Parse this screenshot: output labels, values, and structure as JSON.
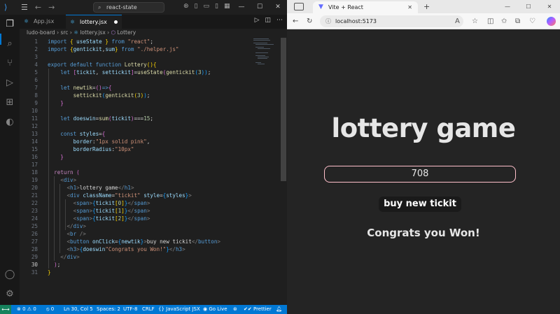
{
  "vscode": {
    "command_center": "react-state",
    "tabs": [
      {
        "label": "App.jsx",
        "active": false,
        "modified": false
      },
      {
        "label": "lottery.jsx",
        "active": true,
        "modified": true
      }
    ],
    "breadcrumb": [
      "ludo-board",
      "src",
      "lottery.jsx",
      "Lottery"
    ],
    "line_numbers": [
      "1",
      "2",
      "3",
      "4",
      "5",
      "6",
      "7",
      "8",
      "9",
      "10",
      "11",
      "12",
      "13",
      "14",
      "15",
      "16",
      "17",
      "18",
      "19",
      "20",
      "21",
      "22",
      "23",
      "24",
      "25",
      "26",
      "27",
      "28",
      "29",
      "30",
      "31"
    ],
    "status": {
      "errors": "0",
      "warnings": "0",
      "ports": "0",
      "position": "Ln 30, Col 5",
      "spaces": "Spaces: 2",
      "encoding": "UTF-8",
      "eol": "CRLF",
      "language": "JavaScript JSX",
      "golive": "Go Live",
      "prettier": "Prettier"
    },
    "icons": [
      "vscode-logo-icon",
      "menu-icon",
      "back-icon",
      "forward-icon",
      "search-icon",
      "layout-icon",
      "run-icon",
      "split-icon",
      "more-icon",
      "files-icon",
      "search-icon",
      "source-control-icon",
      "run-debug-icon",
      "extensions-icon",
      "remote-icon",
      "account-icon",
      "settings-icon",
      "bell-icon"
    ],
    "accent": "#0078d4"
  },
  "browser": {
    "tab_title": "Vite + React",
    "url": "localhost:5173",
    "icons": [
      "sidebar-icon",
      "close-icon",
      "new-tab-icon",
      "back-icon",
      "refresh-icon",
      "info-icon",
      "read-aloud-icon",
      "favorite-icon",
      "split-icon",
      "favorites-icon",
      "collections-icon",
      "browser-essentials-icon",
      "copilot-icon"
    ]
  },
  "app": {
    "heading": "lottery game",
    "ticket": "708",
    "button": "buy new tickit",
    "result": "Congrats you Won!"
  }
}
